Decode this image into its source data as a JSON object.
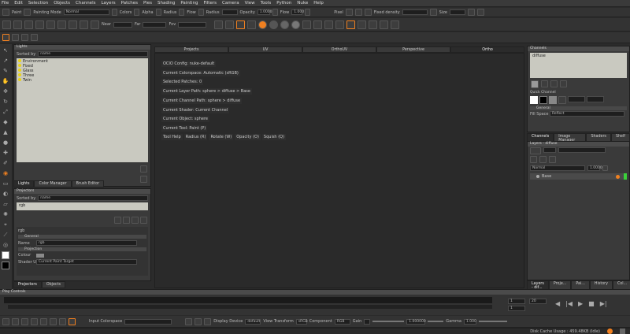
{
  "menu": [
    "File",
    "Edit",
    "Selection",
    "Objects",
    "Channels",
    "Layers",
    "Patches",
    "Pies",
    "Shading",
    "Painting",
    "Filters",
    "Camera",
    "View",
    "Tools",
    "Python",
    "Nuke",
    "Help"
  ],
  "paint_toolbar": {
    "paint_label": "Paint",
    "painting_mode_label": "Painting Mode",
    "painting_mode_value": "Normal",
    "checks": [
      "Colors",
      "Alpha",
      "Radius",
      "Flow",
      "Radius"
    ],
    "opacity_label": "Opacity",
    "opacity_value": "1.0000",
    "flow_label": "Flow",
    "flow_value": "1.000",
    "pixel_label": "Pixel",
    "fixed_density_label": "Fixed density",
    "size_label": "Size"
  },
  "view_toolbar": {
    "near_label": "Near",
    "far_label": "Far",
    "fov_label": "Fov"
  },
  "lights": {
    "title": "Lights",
    "sorted_by_label": "Sorted by",
    "sorted_by_value": "name",
    "items": [
      "Environment",
      "Fixed",
      "Glass",
      "Three",
      "Twin"
    ],
    "tabs": [
      "Lights",
      "Color Manager",
      "Brush Editor"
    ]
  },
  "projectors": {
    "title": "Projectors",
    "sorted_by_label": "Sorted by",
    "sorted_by_value": "name",
    "selected": "rgb",
    "props_header": "rgb",
    "general": "General",
    "name_label": "Name",
    "name_value": "rgb",
    "projection": "Projection",
    "colour_label": "Colour",
    "shader_label": "Shader Used",
    "shader_value": "Current Paint Target",
    "tabs": [
      "Projectors",
      "Objects"
    ]
  },
  "viewport": {
    "tabs": [
      "Projects",
      "UV",
      "OrthoUV",
      "Perspective",
      "Ortho"
    ],
    "info": [
      "OCIO Config: nuke-default",
      "Current Colorspace: Automatic (sRGB)",
      "Selected Patches: 0",
      "Current Layer Path: sphere > diffuse > Base",
      "Current Channel Path: sphere > diffuse",
      "Current Shader: Current Channel",
      "Current Object: sphere",
      "Current Tool: Paint (P)"
    ],
    "hotkeys": [
      "Tool Help",
      "Radius (R)",
      "Rotate (W)",
      "Opacity (O)",
      "Squish (Q)"
    ]
  },
  "channels": {
    "title": "Channels",
    "entry": "diffuse",
    "quick_channel": "Quick Channel",
    "general": "General",
    "fill_label": "Fill Space",
    "fill_value": "Reflect",
    "tabs": [
      "Channels",
      "Image Manager",
      "Shaders",
      "Shelf"
    ]
  },
  "layers": {
    "title": "Layers - diffuse",
    "mode": "Normal",
    "opacity": "1.0000",
    "base": "Base",
    "tabs": [
      "Layers - dif...",
      "Proje...",
      "Pai...",
      "History",
      "Col..."
    ]
  },
  "play_controls": {
    "title": "Play Controls",
    "frame": "1",
    "start": "1",
    "end": "20"
  },
  "bottom_bar": {
    "input_colorspace_label": "Input Colorspace",
    "display_device_label": "Display Device",
    "display_device_value": "default",
    "view_transform_label": "View Transform",
    "view_transform_value": "sRGB",
    "component_label": "Component",
    "component_value": "RGB",
    "gain_label": "Gain",
    "gain_value": "1.000000",
    "gamma_label": "Gamma",
    "gamma_value": "1.000"
  },
  "status": {
    "disk_cache": "Disk Cache Usage : 459.48KB (Idle)"
  }
}
